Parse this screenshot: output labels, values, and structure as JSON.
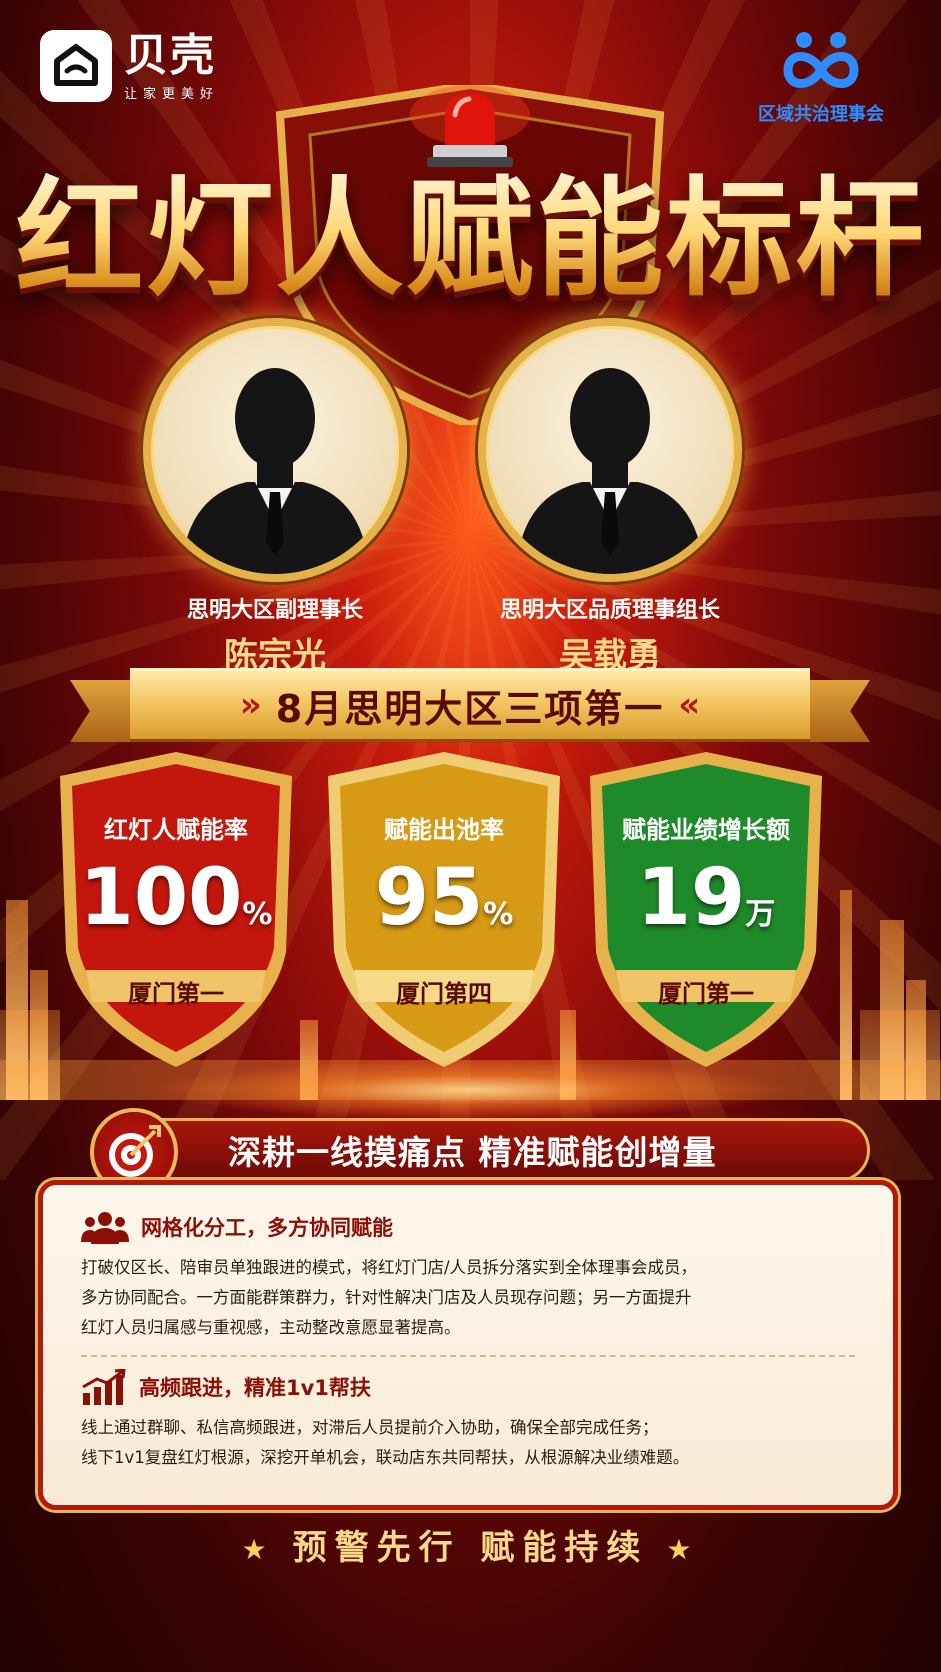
{
  "brand": {
    "name": "贝壳",
    "slogan": "让家更美好"
  },
  "council": {
    "name": "区域共治理事会"
  },
  "title": "红灯人赋能标杆",
  "people": [
    {
      "title": "思明大区副理事长",
      "name": "陈宗光"
    },
    {
      "title": "思明大区品质理事组长",
      "name": "吴载勇"
    }
  ],
  "banner": {
    "chev_left": "»",
    "text": "8月思明大区三项第一",
    "chev_right": "«"
  },
  "stats": [
    {
      "label": "红灯人赋能率",
      "value": "100",
      "unit": "%",
      "rank": "厦门第一",
      "color": "#c3170e"
    },
    {
      "label": "赋能出池率",
      "value": "95",
      "unit": "%",
      "rank": "厦门第四",
      "color": "#d69a14"
    },
    {
      "label": "赋能业绩增长额",
      "value": "19",
      "unit": "万",
      "rank": "厦门第一",
      "color": "#1f8a2a"
    }
  ],
  "section": {
    "title": "深耕一线摸痛点  精准赋能创增量",
    "icon": "target-icon"
  },
  "blocks": [
    {
      "icon": "team-icon",
      "title": "网格化分工，多方协同赋能",
      "lines": [
        "打破仅区长、陪审员单独跟进的模式，将红灯门店/人员拆分落实到全体理事会成员，",
        "多方协同配合。一方面能群策群力，针对性解决门店及人员现存问题；另一方面提升",
        "红灯人员归属感与重视感，主动整改意愿显著提高。"
      ]
    },
    {
      "icon": "growth-chart-icon",
      "title": "高频跟进，精准1v1帮扶",
      "lines": [
        "线上通过群聊、私信高频跟进，对滞后人员提前介入协助，确保全部完成任务；",
        "线下1v1复盘红灯根源，深挖开单机会，联动店东共同帮扶，从根源解决业绩难题。"
      ]
    }
  ],
  "footer": {
    "star": "★",
    "text": "预警先行  赋能持续"
  }
}
